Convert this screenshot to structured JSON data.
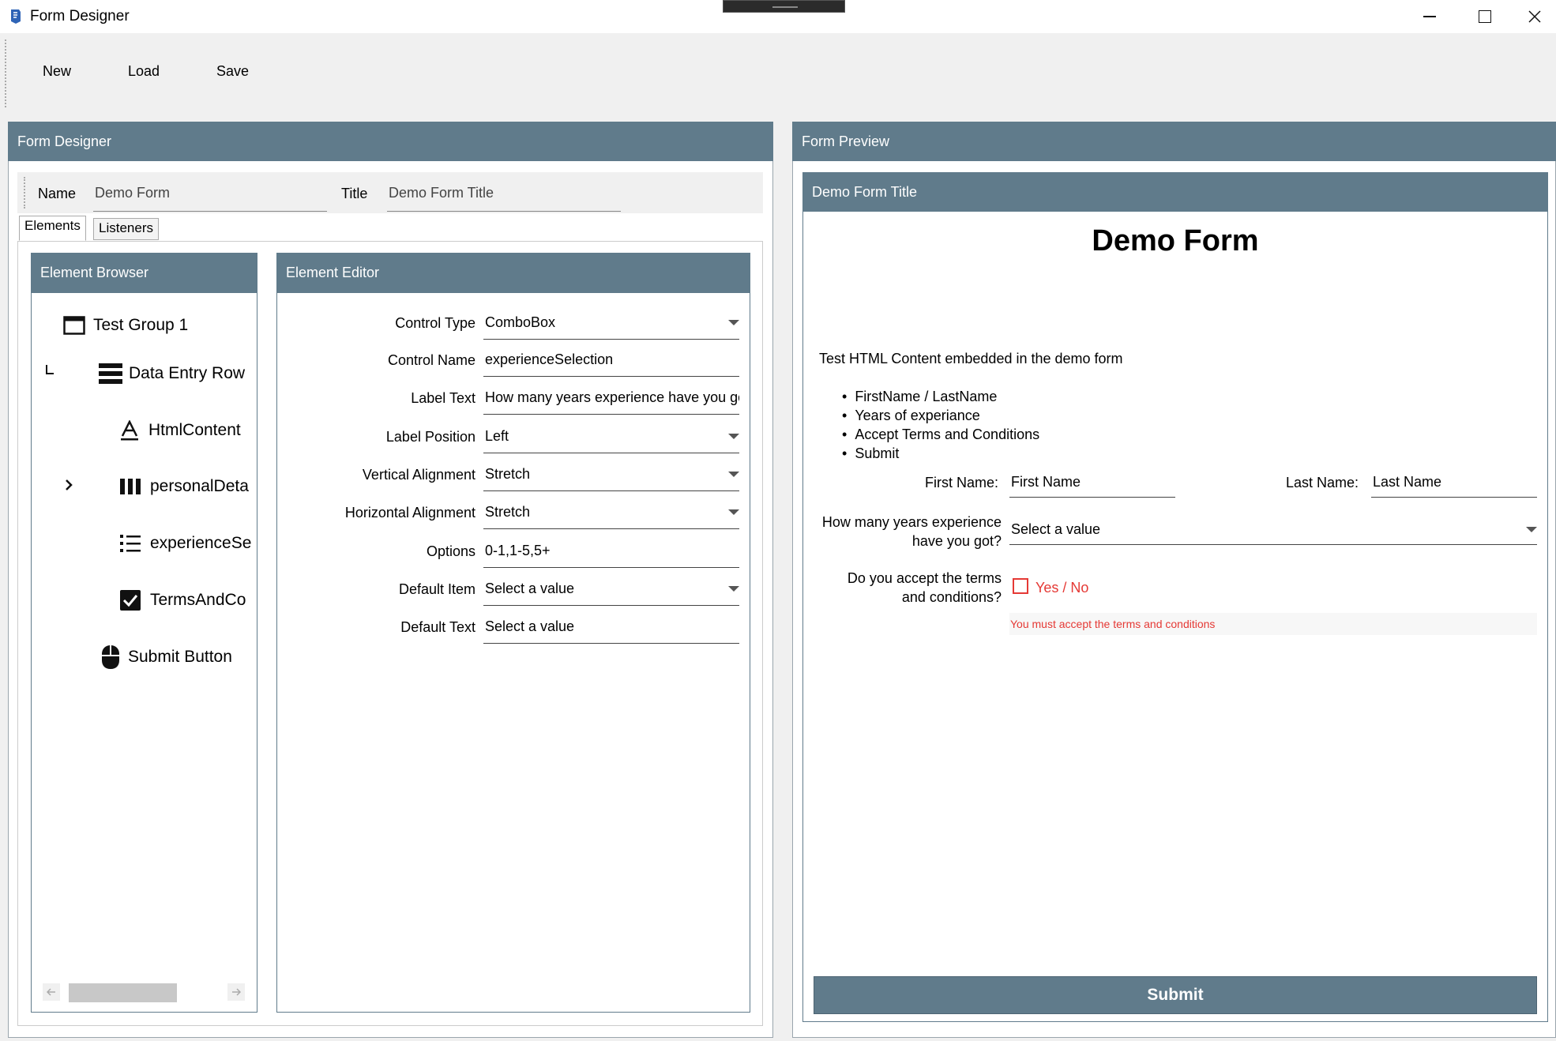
{
  "window": {
    "title": "Form Designer",
    "minimize": "—",
    "maximize": "☐",
    "close": "✕"
  },
  "toolbar": {
    "new_label": "New",
    "load_label": "Load",
    "save_label": "Save"
  },
  "designer": {
    "header": "Form Designer",
    "name_label": "Name",
    "name_value": "Demo Form",
    "title_label": "Title",
    "title_value": "Demo Form Title",
    "tabs": [
      "Elements",
      "Listeners"
    ],
    "active_tab": "Elements"
  },
  "browser": {
    "header": "Element Browser",
    "items": [
      {
        "label": "Test Group 1",
        "icon": "group-box-icon"
      },
      {
        "label": "Data Entry Row",
        "icon": "rows-icon"
      },
      {
        "label": "HtmlContent",
        "icon": "text-icon"
      },
      {
        "label": "personalDeta",
        "icon": "columns-icon"
      },
      {
        "label": "experienceSe",
        "icon": "list-icon"
      },
      {
        "label": "TermsAndCo",
        "icon": "checkbox-icon"
      },
      {
        "label": "Submit Button",
        "icon": "mouse-icon"
      }
    ]
  },
  "editor": {
    "header": "Element Editor",
    "fields": [
      {
        "label": "Control Type",
        "value": "ComboBox",
        "combo": true
      },
      {
        "label": "Control Name",
        "value": "experienceSelection",
        "combo": false
      },
      {
        "label": "Label Text",
        "value": "How many years experience have you gc",
        "combo": false
      },
      {
        "label": "Label Position",
        "value": "Left",
        "combo": true
      },
      {
        "label": "Vertical Alignment",
        "value": "Stretch",
        "combo": true
      },
      {
        "label": "Horizontal Alignment",
        "value": "Stretch",
        "combo": true
      },
      {
        "label": "Options",
        "value": "0-1,1-5,5+",
        "combo": false
      },
      {
        "label": "Default Item",
        "value": "Select a value",
        "combo": true
      },
      {
        "label": "Default Text",
        "value": "Select a value",
        "combo": false
      }
    ]
  },
  "preview": {
    "header": "Form Preview",
    "form_title": "Demo Form Title",
    "form_heading": "Demo Form",
    "html_intro": "Test HTML Content embedded in the demo form",
    "bullets": [
      "FirstName / LastName",
      "Years of experiance",
      "Accept Terms and Conditions",
      "Submit"
    ],
    "first_name_label": "First Name:",
    "first_name_placeholder": "First Name",
    "last_name_label": "Last Name:",
    "last_name_placeholder": "Last Name",
    "experience_label_line1": "How many years experience",
    "experience_label_line2": "have you got?",
    "experience_value": "Select a value",
    "terms_label_line1": "Do you accept the terms",
    "terms_label_line2": "and conditions?",
    "terms_checkbox_label": "Yes / No",
    "terms_error": "You must accept the terms and conditions",
    "submit_label": "Submit"
  },
  "colors": {
    "header_bg": "#607b8b",
    "error": "#e53935"
  }
}
